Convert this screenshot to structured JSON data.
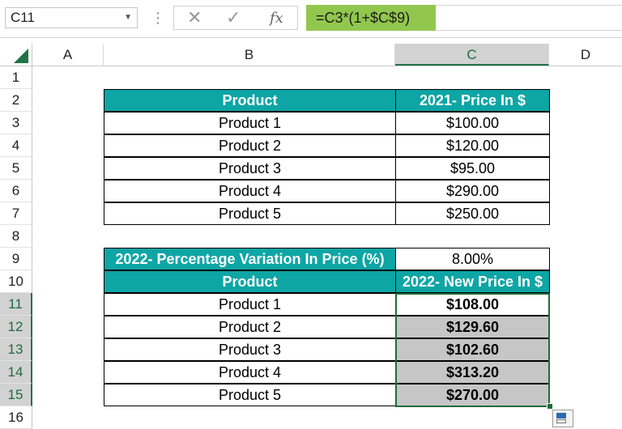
{
  "formula_bar": {
    "name_box": "C11",
    "cancel_icon": "✕",
    "enter_icon": "✓",
    "function_label": "fx",
    "formula": "=C3*(1+$C$9)"
  },
  "columns": [
    "A",
    "B",
    "C",
    "D"
  ],
  "rows": [
    "1",
    "2",
    "3",
    "4",
    "5",
    "6",
    "7",
    "8",
    "9",
    "10",
    "11",
    "12",
    "13",
    "14",
    "15",
    "16"
  ],
  "table1": {
    "headers": [
      "Product",
      "2021- Price In $"
    ],
    "rows": [
      [
        "Product 1",
        "$100.00"
      ],
      [
        "Product 2",
        "$120.00"
      ],
      [
        "Product 3",
        "$95.00"
      ],
      [
        "Product 4",
        "$290.00"
      ],
      [
        "Product 5",
        "$250.00"
      ]
    ]
  },
  "variation": {
    "label": "2022- Percentage Variation In Price (%)",
    "value": "8.00%"
  },
  "table2": {
    "headers": [
      "Product",
      "2022- New Price In $"
    ],
    "rows": [
      [
        "Product 1",
        "$108.00"
      ],
      [
        "Product 2",
        "$129.60"
      ],
      [
        "Product 3",
        "$102.60"
      ],
      [
        "Product 4",
        "$313.20"
      ],
      [
        "Product 5",
        "$270.00"
      ]
    ]
  },
  "colors": {
    "header_teal": "#0ea5a5",
    "formula_green": "#92c74e",
    "selection_green": "#217346",
    "selected_gray": "#c6c6c6"
  }
}
